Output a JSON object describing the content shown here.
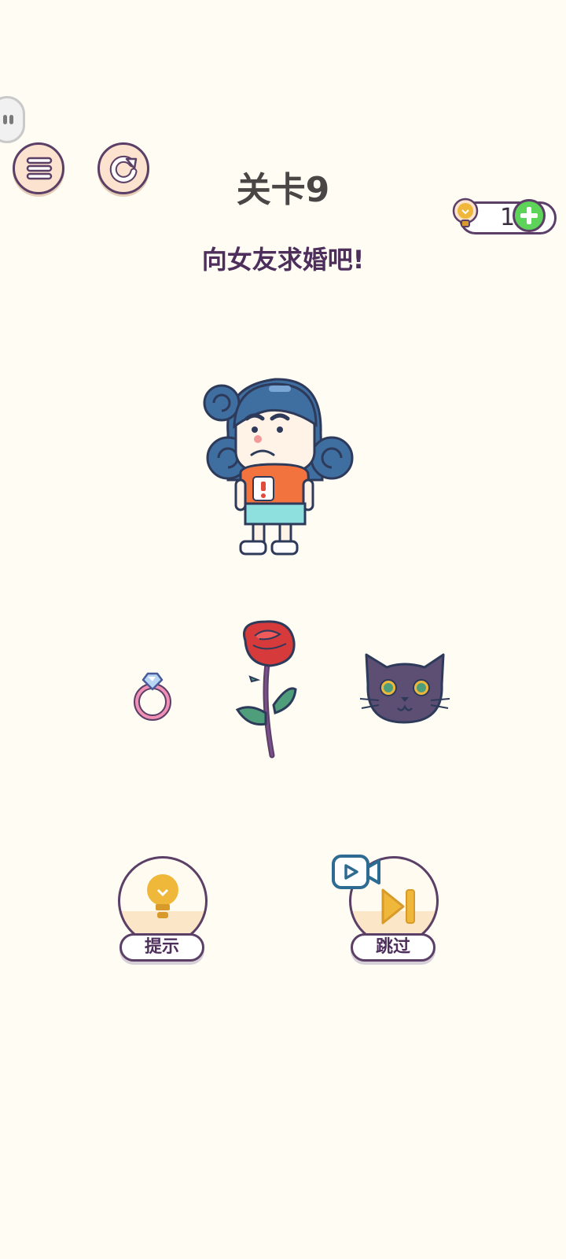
{
  "header": {
    "level_title": "关卡9",
    "subtitle": "向女友求婚吧!"
  },
  "hint_counter": {
    "count": "1"
  },
  "scene": {
    "character": "girlfriend",
    "items": [
      "ring",
      "rose",
      "cat"
    ]
  },
  "actions": {
    "hint_label": "提示",
    "skip_label": "跳过"
  },
  "colors": {
    "background": "#fefcf3",
    "outline": "#5b3f66",
    "button_fill": "#fbe3cf",
    "bulb": "#f0b83a",
    "plus": "#5dd35a",
    "skip_icon": "#f0b83a",
    "video_icon": "#2e6b92"
  },
  "icons": {
    "floating_button": "floating-assistant-icon",
    "menu": "menu-icon",
    "restart": "restart-icon",
    "hint": "lightbulb-icon",
    "add": "plus-icon",
    "skip": "skip-forward-icon",
    "video": "video-icon"
  }
}
